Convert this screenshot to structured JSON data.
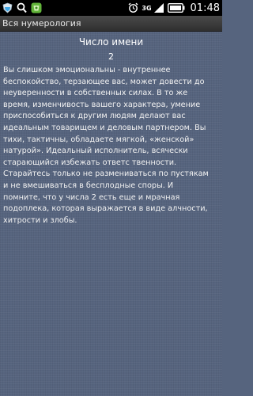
{
  "status_bar": {
    "network_label": "3G",
    "time": "01:48",
    "icons": [
      "shield-icon",
      "search-icon",
      "app-notification-icon",
      "alarm-icon",
      "signal-icon",
      "battery-icon"
    ]
  },
  "app": {
    "title": "Вся нумерология"
  },
  "content": {
    "heading": "Число имени",
    "number": "2",
    "body": "Вы слишком эмоциональны - внутреннее\nбеспокойство, терзающее вас, может довести до\nнеуверенности в собственных силах. В то же\nвремя, изменчивость вашего характера, умение\nприспособиться к другим людям делают вас\nидеальным товарищем и деловым партнером. Вы\nтихи, тактичны, обладаете мягкой, «женской»\nнатурой». Идеальный исполнитель, всячески\nстарающийся избежать ответс твенности.\nСтарайтесь только не размениваться по пустякам\nи не вмешиваться в бесплодные споры. И\nпомните, что у числа 2 есть еще и мрачная\nподоплека, которая выражается в виде алчности,\nхитрости и злобы."
  },
  "colors": {
    "background": "#56647e",
    "status_bar": "#000000",
    "title_bar": "#3a3a3a",
    "text": "#ffffff"
  }
}
